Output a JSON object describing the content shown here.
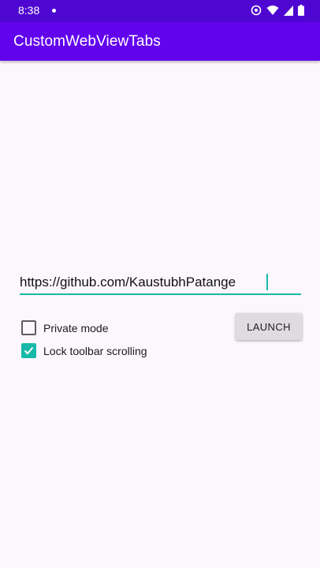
{
  "status_bar": {
    "time": "8:38",
    "icons": [
      "notification-dot-icon",
      "data-saver-icon",
      "wifi-icon",
      "signal-icon",
      "battery-icon"
    ]
  },
  "app_bar": {
    "title": "CustomWebViewTabs"
  },
  "form": {
    "url_value": "https://github.com/KaustubhPatange",
    "private_mode_label": "Private mode",
    "private_mode_checked": false,
    "lock_toolbar_label": "Lock toolbar scrolling",
    "lock_toolbar_checked": true,
    "launch_label": "LAUNCH"
  },
  "colors": {
    "status_bar": "#4e07d1",
    "app_bar": "#6203ee",
    "accent": "#16b9a8",
    "background": "#fbf7fd",
    "button": "#dfdcdf"
  }
}
